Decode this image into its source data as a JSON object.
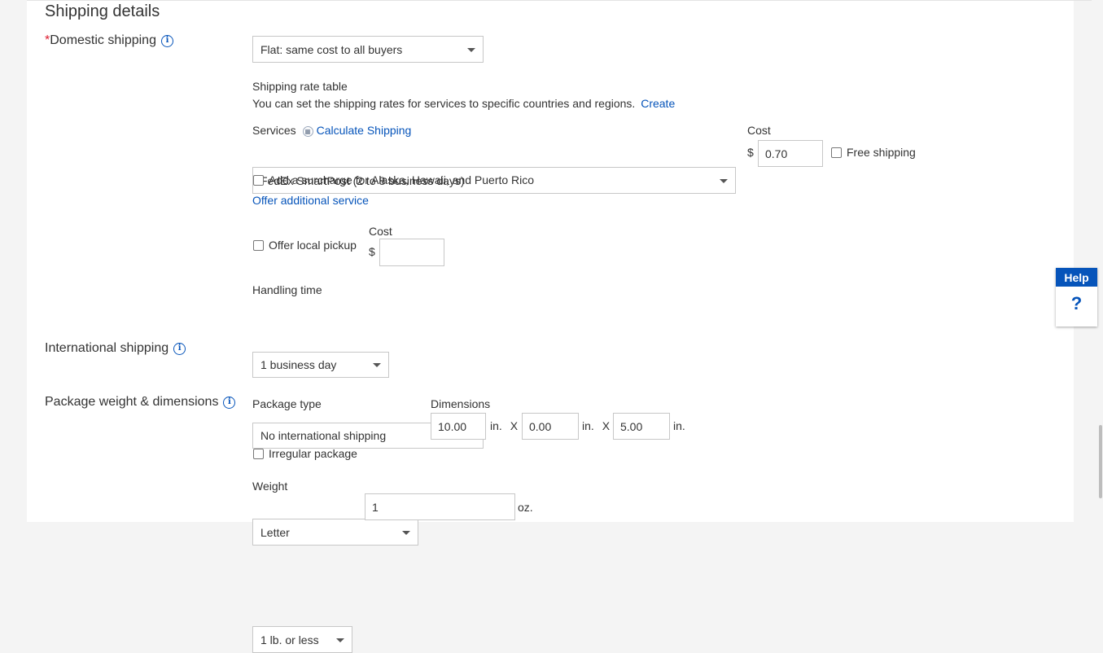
{
  "section": {
    "title": "Shipping details"
  },
  "domestic": {
    "required_mark": "*",
    "label": "Domestic shipping",
    "select_value": "Flat: same cost to all buyers",
    "rate_table_title": "Shipping rate table",
    "rate_table_desc": "You can set the shipping rates for services to specific countries and regions.",
    "rate_table_link": "Create",
    "services_label": "Services",
    "calculate_link": "Calculate Shipping",
    "service_value": "FedEx SmartPost (2 to 8 business days)",
    "cost_label": "Cost",
    "currency": "$",
    "cost_value": "0.70",
    "free_shipping_label": "Free shipping",
    "surcharge_label": "Add a surcharge for Alaska, Hawaii, and Puerto Rico",
    "additional_service_link": "Offer additional service",
    "local_pickup_label": "Offer local pickup",
    "pickup_cost_label": "Cost",
    "pickup_currency": "$",
    "pickup_cost_value": "",
    "handling_label": "Handling time",
    "handling_value": "1 business day"
  },
  "international": {
    "label": "International shipping",
    "select_value": "No international shipping"
  },
  "package": {
    "label": "Package weight & dimensions",
    "type_label": "Package type",
    "type_value": "Letter",
    "dimensions_label": "Dimensions",
    "dim1": "10.00",
    "dim2": "0.00",
    "dim3": "5.00",
    "unit_in": "in.",
    "times": "X",
    "irregular_label": "Irregular package",
    "weight_label": "Weight",
    "weight_select": "1 lb. or less",
    "weight_value": "1",
    "weight_unit": "oz."
  },
  "help": {
    "title": "Help",
    "symbol": "?"
  },
  "colors": {
    "link": "#0654ba",
    "required": "#dd1e31",
    "help_bg": "#0654ba"
  },
  "icons": {
    "info": "info-icon",
    "calculator": "calculator-icon",
    "dropdown": "chevron-down-icon"
  }
}
